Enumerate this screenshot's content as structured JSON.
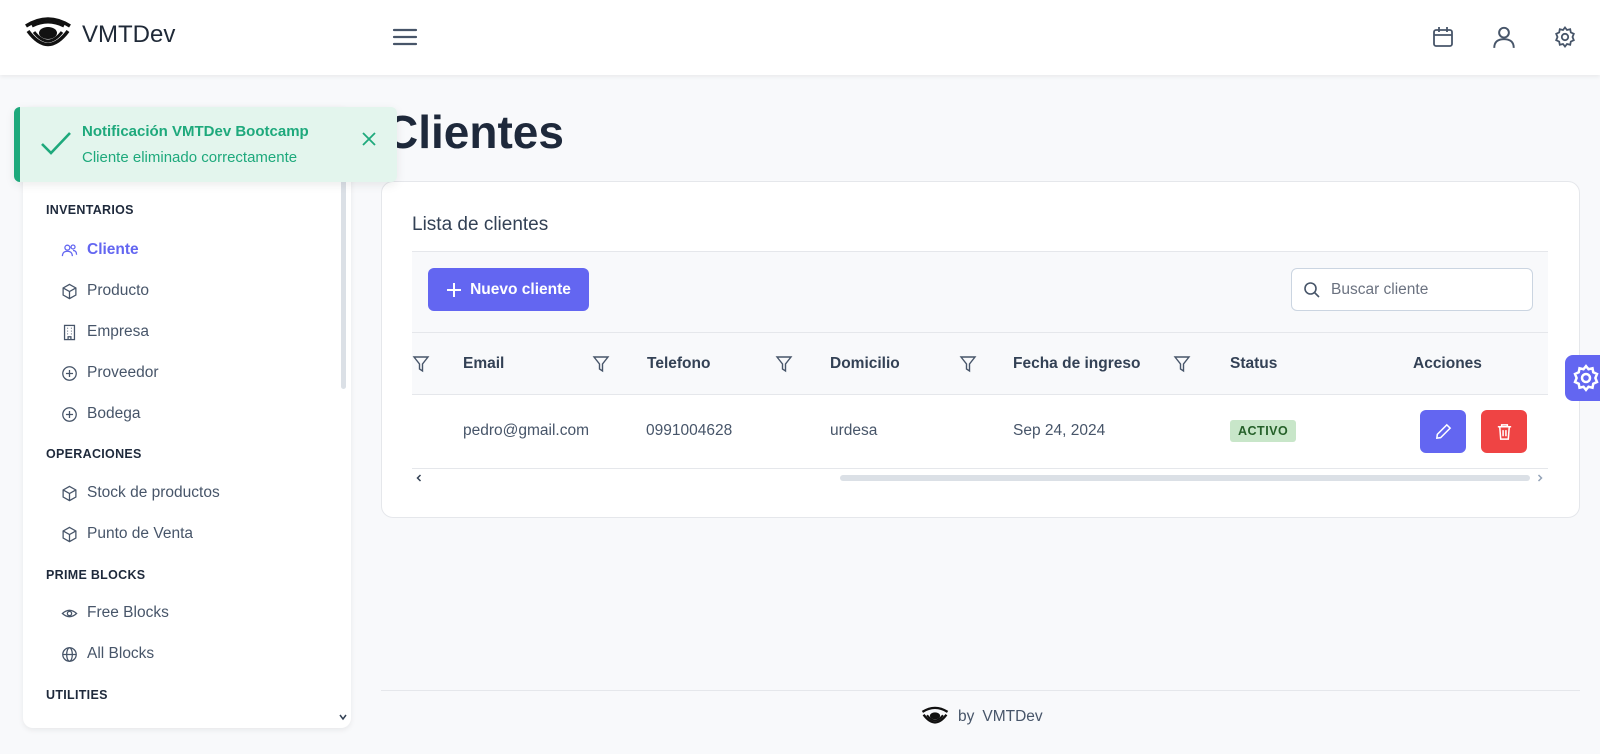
{
  "app": {
    "name": "VMTDev"
  },
  "topbar": {
    "icons": [
      "menu-icon",
      "calendar-icon",
      "user-icon",
      "settings-icon"
    ]
  },
  "toast": {
    "title": "Notificación VMTDev Bootcamp",
    "message": "Cliente eliminado correctamente",
    "color": "#1ea97c"
  },
  "sidebar": {
    "sections": [
      {
        "title": "INVENTARIOS",
        "items": [
          {
            "label": "Cliente",
            "icon": "users-icon",
            "active": true
          },
          {
            "label": "Producto",
            "icon": "box-icon"
          },
          {
            "label": "Empresa",
            "icon": "building-icon"
          },
          {
            "label": "Proveedor",
            "icon": "plus-circle-icon"
          },
          {
            "label": "Bodega",
            "icon": "plus-circle-icon"
          }
        ]
      },
      {
        "title": "OPERACIONES",
        "items": [
          {
            "label": "Stock de productos",
            "icon": "box-icon"
          },
          {
            "label": "Punto de Venta",
            "icon": "box-icon"
          }
        ]
      },
      {
        "title": "PRIME BLOCKS",
        "items": [
          {
            "label": "Free Blocks",
            "icon": "eye-icon"
          },
          {
            "label": "All Blocks",
            "icon": "globe-icon"
          }
        ]
      },
      {
        "title": "UTILITIES",
        "items": []
      }
    ]
  },
  "page": {
    "title": "Clientes"
  },
  "card": {
    "title": "Lista de clientes",
    "new_button": "Nuevo cliente",
    "search_placeholder": "Buscar cliente"
  },
  "table": {
    "columns": [
      "Email",
      "Telefono",
      "Domicilio",
      "Fecha de ingreso",
      "Status",
      "Acciones"
    ],
    "rows": [
      {
        "email": "pedro@gmail.com",
        "telefono": "0991004628",
        "domicilio": "urdesa",
        "fecha": "Sep 24, 2024",
        "status": "ACTIVO"
      }
    ]
  },
  "footer": {
    "prefix": "by",
    "brand": "VMTDev"
  },
  "colors": {
    "primary": "#6366f1",
    "danger": "#ef4444",
    "success": "#1ea97c"
  }
}
